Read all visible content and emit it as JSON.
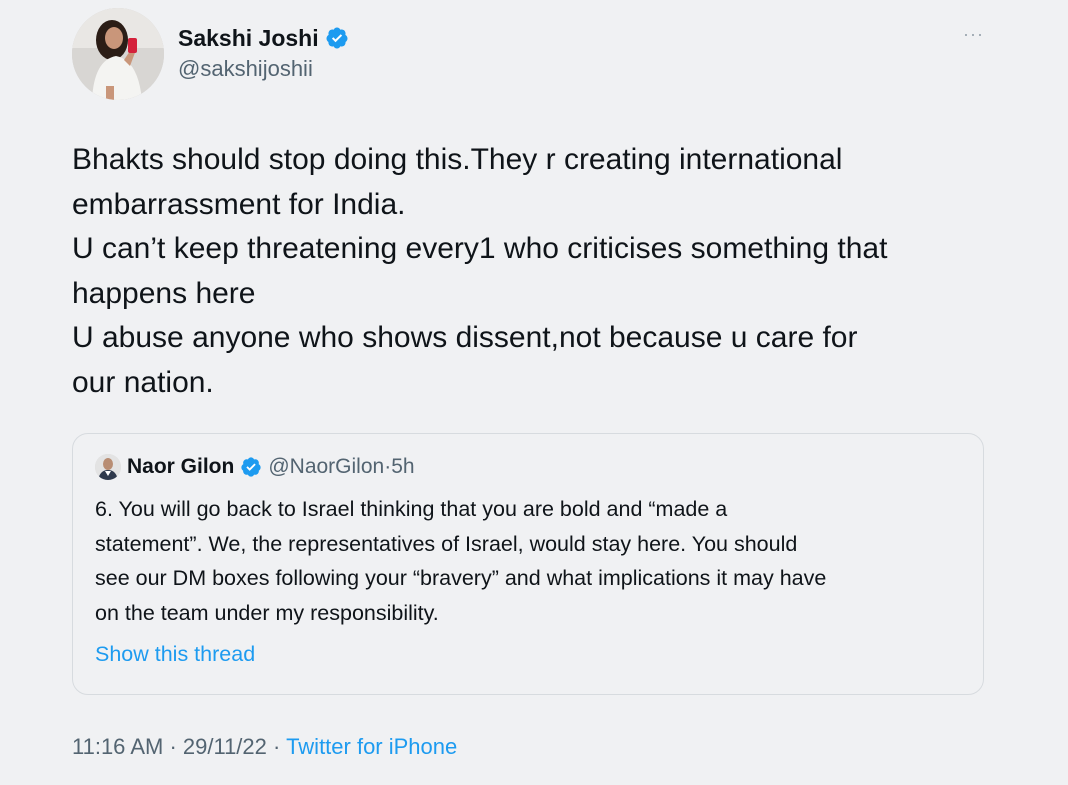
{
  "author": {
    "name": "Sakshi Joshi",
    "handle": "@sakshijoshii",
    "avatar_icon": "profile-photo",
    "verified_icon": "verified-badge-icon"
  },
  "more_label": "···",
  "tweet_lines": [
    "Bhakts should stop doing this.They r creating international",
    "embarrassment for India.",
    "U can’t keep threatening every1 who criticises something that",
    "happens here",
    "U abuse anyone who shows dissent,not because u care for",
    "our nation."
  ],
  "quote": {
    "name": "Naor Gilon",
    "handle": "@NaorGilon",
    "dot": "·",
    "time": "5h",
    "lines": [
      "6. You will go back to Israel thinking that you are bold and “made a",
      "statement”. We, the representatives of Israel, would stay here. You should",
      "see our DM boxes following your “bravery” and what implications it may have",
      "on the team under my responsibility."
    ],
    "show_thread": "Show this thread"
  },
  "meta": {
    "time": "11:16 AM",
    "sep1": " · ",
    "date": "29/11/22",
    "sep2": " · ",
    "source": "Twitter for iPhone"
  },
  "colors": {
    "background": "#f0f1f3",
    "link": "#1d9bf0",
    "secondary_text": "#536471",
    "verified": "#1d9bf0"
  }
}
